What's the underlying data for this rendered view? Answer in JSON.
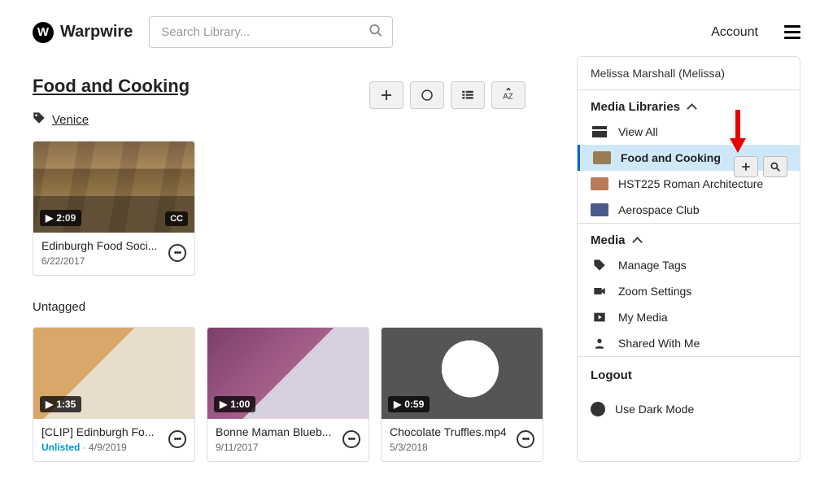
{
  "brand": "Warpwire",
  "search": {
    "placeholder": "Search Library..."
  },
  "account_label": "Account",
  "library": {
    "title": "Food and Cooking",
    "tag_link": "Venice",
    "untagged_label": "Untagged"
  },
  "venice_cards": [
    {
      "duration": "2:09",
      "cc": "CC",
      "title": "Edinburgh Food Soci...",
      "date": "6/22/2017"
    }
  ],
  "untagged_cards": [
    {
      "duration": "1:35",
      "title": "[CLIP] Edinburgh Fo...",
      "status": "Unlisted",
      "date": "4/9/2019"
    },
    {
      "duration": "1:00",
      "title": "Bonne Maman Blueb...",
      "date": "9/11/2017"
    },
    {
      "duration": "0:59",
      "title": "Chocolate Truffles.mp4",
      "date": "5/3/2018"
    }
  ],
  "sidebar": {
    "user": "Melissa Marshall (Melissa)",
    "libraries_heading": "Media Libraries",
    "view_all": "View All",
    "libraries": [
      {
        "label": "Food and Cooking",
        "active": true
      },
      {
        "label": "HST225 Roman Architecture"
      },
      {
        "label": "Aerospace Club"
      }
    ],
    "media_heading": "Media",
    "media_items": [
      {
        "label": "Manage Tags",
        "icon": "tag"
      },
      {
        "label": "Zoom Settings",
        "icon": "video"
      },
      {
        "label": "My Media",
        "icon": "play"
      },
      {
        "label": "Shared With Me",
        "icon": "person"
      }
    ],
    "logout": "Logout",
    "dark_mode": "Use Dark Mode"
  }
}
